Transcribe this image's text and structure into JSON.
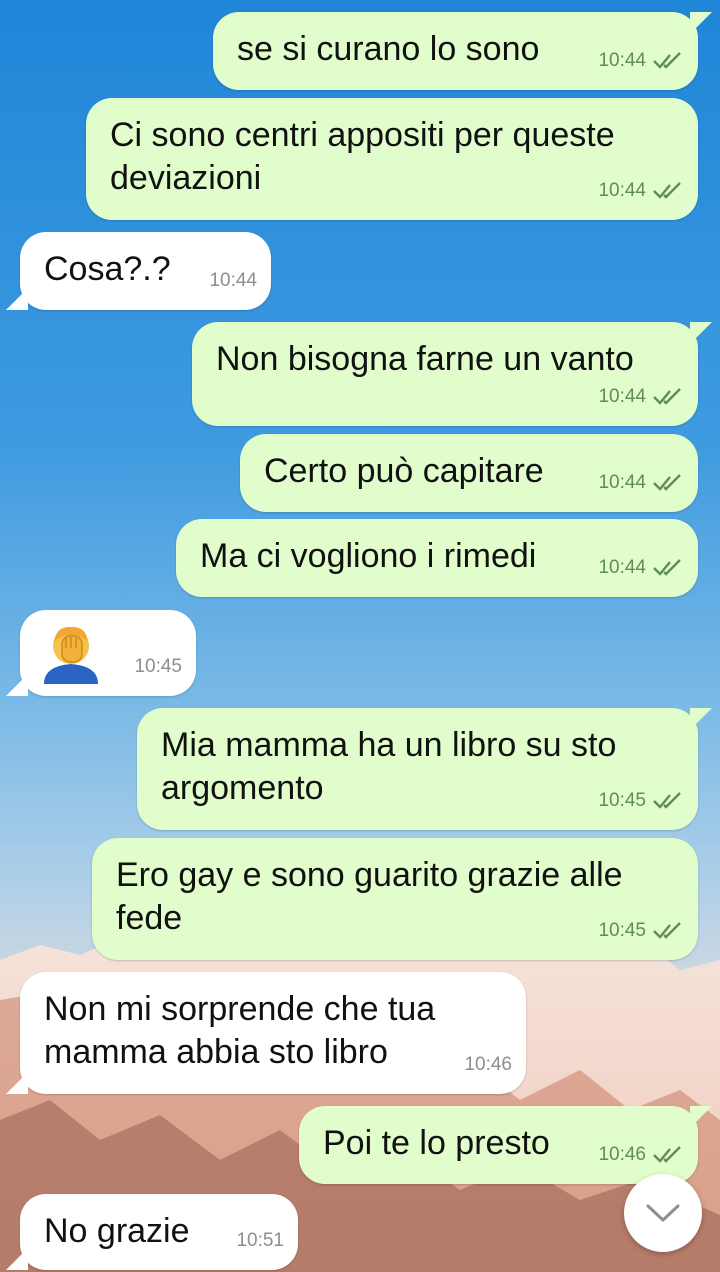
{
  "messages": [
    {
      "text": "se si curano lo sono",
      "time": "10:44"
    },
    {
      "text": "Ci sono centri appositi per queste deviazioni",
      "time": "10:44"
    },
    {
      "text": "Cosa?.?",
      "time": "10:44"
    },
    {
      "text": "Non bisogna farne un vanto",
      "time": "10:44"
    },
    {
      "text": "Certo può capitare",
      "time": "10:44"
    },
    {
      "text": "Ma ci vogliono i rimedi",
      "time": "10:44"
    },
    {
      "emoji": "face-palm-person",
      "time": "10:45"
    },
    {
      "text": "Mia mamma ha un libro su sto argomento",
      "time": "10:45"
    },
    {
      "text": "Ero gay e sono guarito grazie alle fede",
      "time": "10:45"
    },
    {
      "text": "Non mi sorprende che tua mamma abbia sto libro",
      "time": "10:46"
    },
    {
      "text": "Poi te lo presto",
      "time": "10:46"
    },
    {
      "text": "No grazie",
      "time": "10:51"
    }
  ],
  "colors": {
    "outgoing_bubble": "#e2fdcc",
    "incoming_bubble": "#ffffff",
    "read_ticks": "#5f8d4f"
  },
  "icons": {
    "read_receipt": "double-check-icon",
    "scroll_down": "chevron-down-icon"
  }
}
